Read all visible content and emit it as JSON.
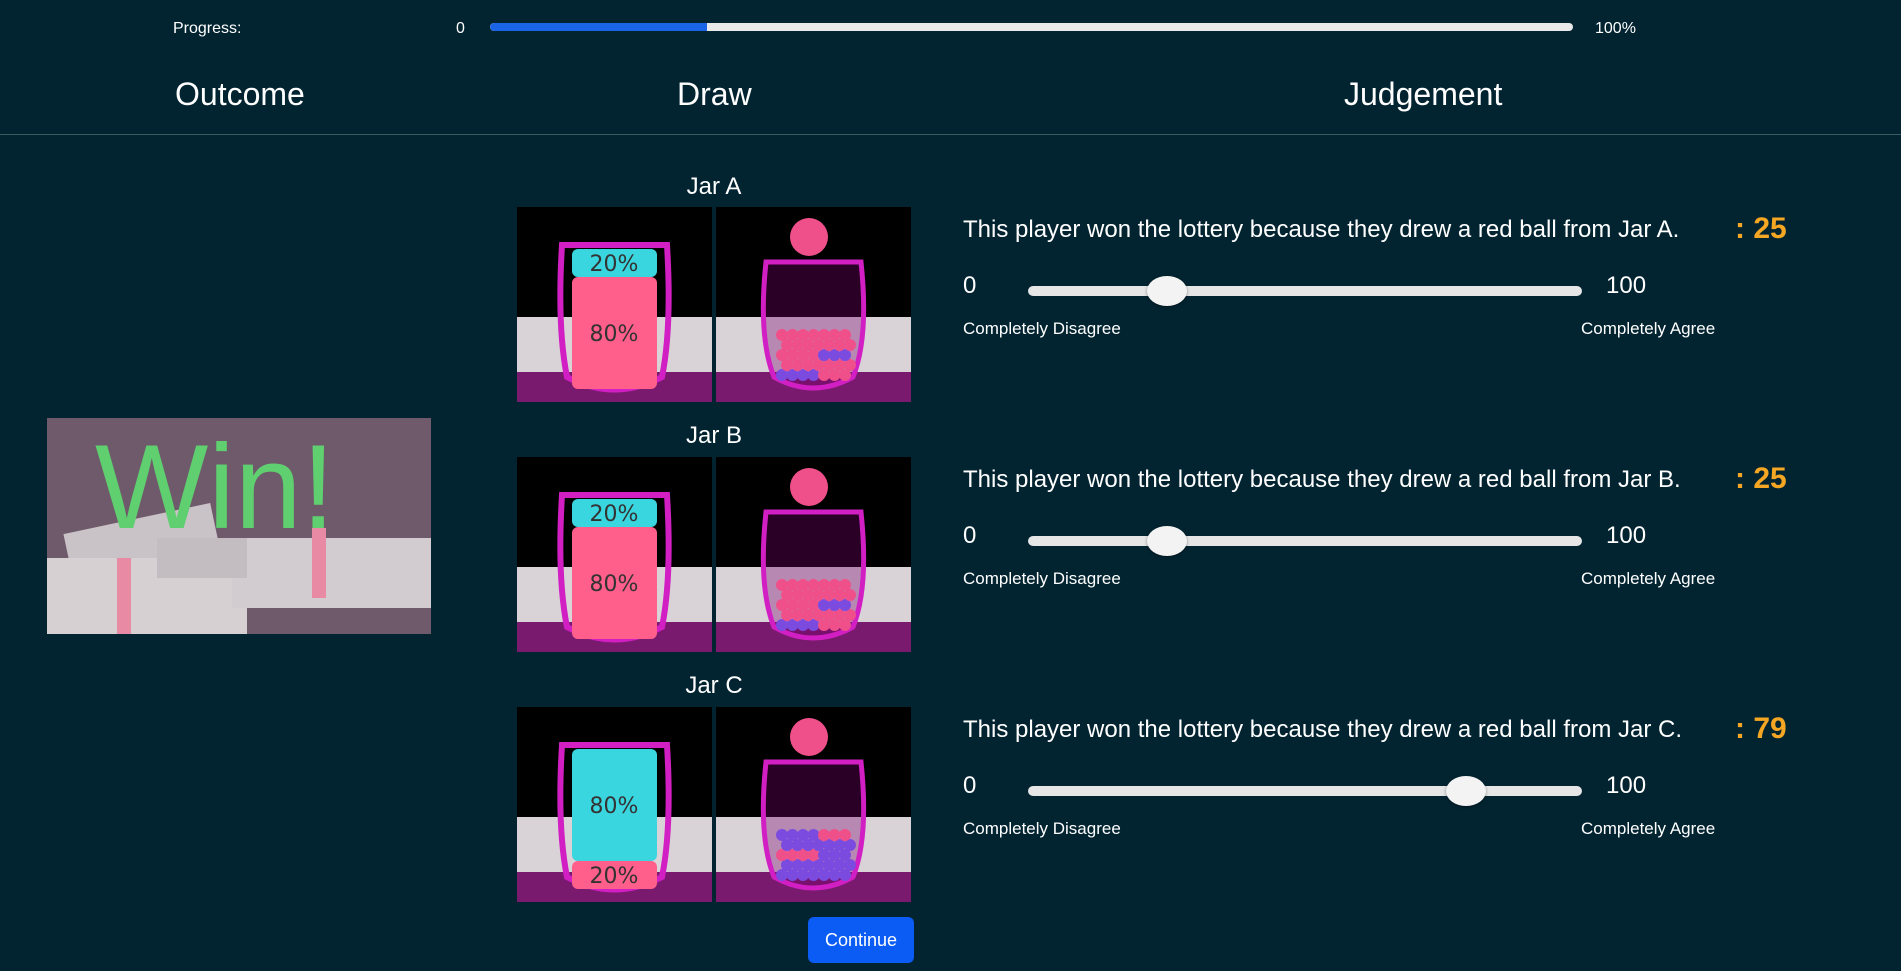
{
  "progress": {
    "label": "Progress:",
    "min_label": "0",
    "max_label": "100%",
    "value_percent": 20
  },
  "headers": {
    "outcome": "Outcome",
    "draw": "Draw",
    "judgement": "Judgement"
  },
  "outcome": {
    "text": "Win!"
  },
  "jars": [
    {
      "title": "Jar A",
      "top_label": "20%",
      "bottom_label": "80%",
      "top_color": "#3ad6e0",
      "bottom_color": "#ff5f8a",
      "top_share": 0.2,
      "drawn_color": "#f0508a",
      "statement": "This player won the lottery because they drew a red ball from Jar A.",
      "score": ": 25",
      "value": 25
    },
    {
      "title": "Jar B",
      "top_label": "20%",
      "bottom_label": "80%",
      "top_color": "#3ad6e0",
      "bottom_color": "#ff5f8a",
      "top_share": 0.2,
      "drawn_color": "#f0508a",
      "statement": "This player won the lottery because they drew a red ball from Jar B.",
      "score": ": 25",
      "value": 25
    },
    {
      "title": "Jar C",
      "top_label": "80%",
      "bottom_label": "20%",
      "top_color": "#3ad6e0",
      "bottom_color": "#ff5f8a",
      "top_share": 0.8,
      "drawn_color": "#f0508a",
      "statement": "This player won the lottery because they drew a red ball from Jar C.",
      "score": ": 79",
      "value": 79
    }
  ],
  "slider": {
    "min": "0",
    "max": "100",
    "left_label": "Completely Disagree",
    "right_label": "Completely Agree"
  },
  "continue_label": "Continue",
  "colors": {
    "background": "#022431",
    "accent": "#1a64e6",
    "score": "#f5a623",
    "button": "#0b5cf5"
  }
}
